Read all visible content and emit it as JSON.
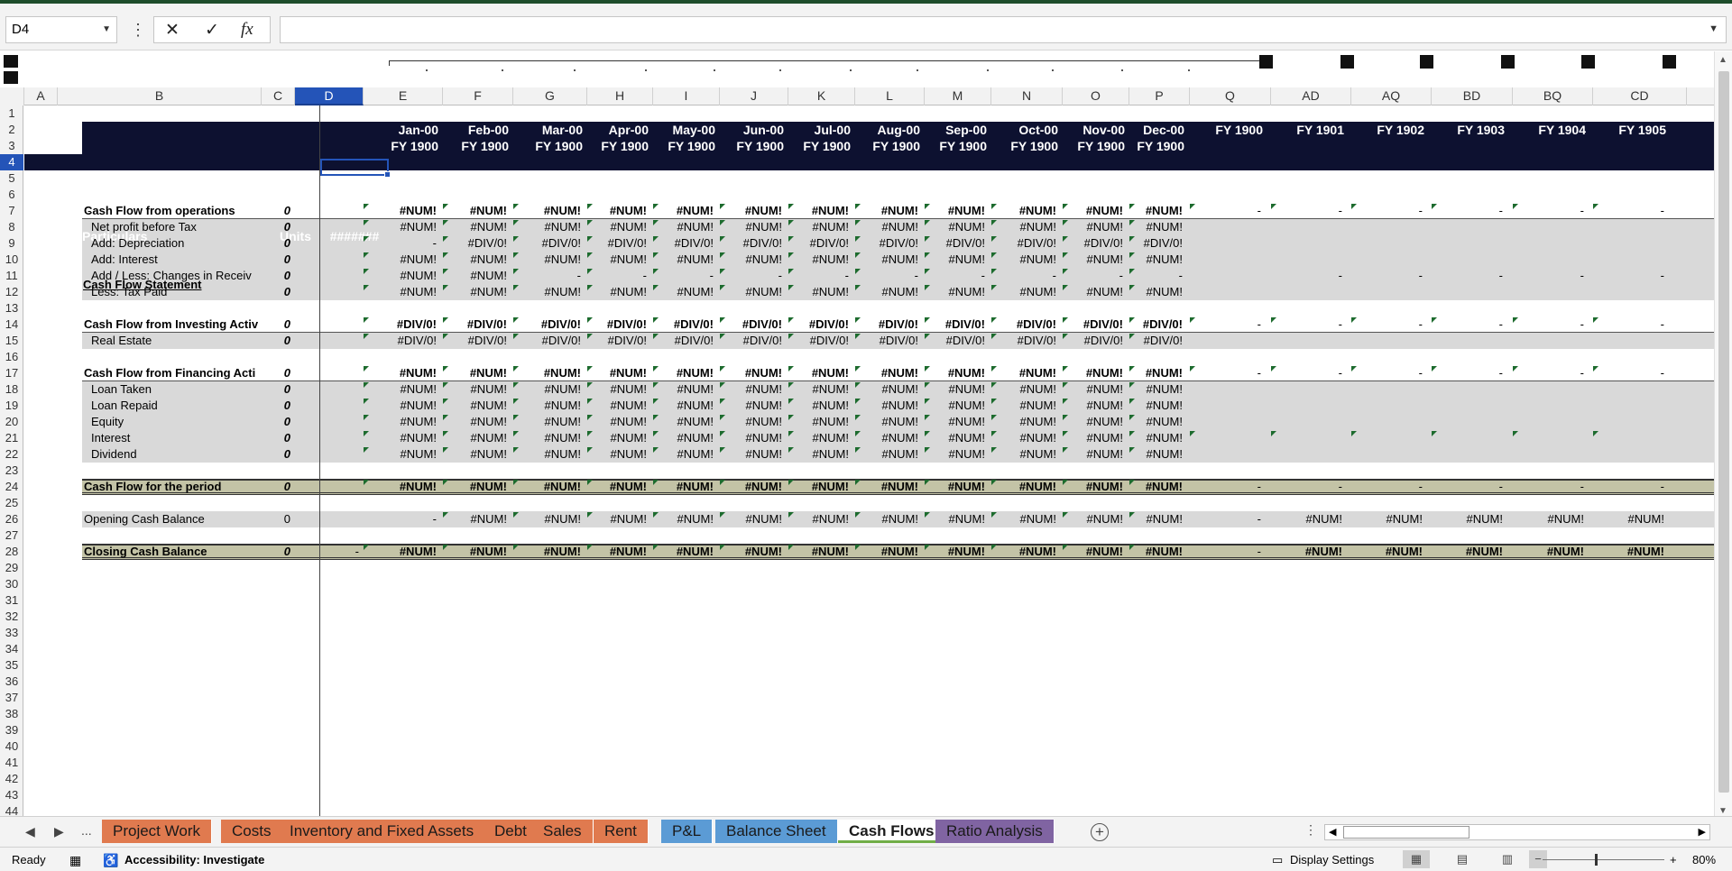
{
  "formula_bar": {
    "name_box": "D4",
    "cancel_icon": "✕",
    "enter_icon": "✓",
    "function_icon": "fx",
    "formula": ""
  },
  "columns": [
    {
      "label": "A"
    },
    {
      "label": "B"
    },
    {
      "label": "C"
    },
    {
      "label": "D",
      "selected": true
    },
    {
      "label": "E"
    },
    {
      "label": "F"
    },
    {
      "label": "G"
    },
    {
      "label": "H"
    },
    {
      "label": "I"
    },
    {
      "label": "J"
    },
    {
      "label": "K"
    },
    {
      "label": "L"
    },
    {
      "label": "M"
    },
    {
      "label": "N"
    },
    {
      "label": "O"
    },
    {
      "label": "P"
    },
    {
      "label": "Q"
    },
    {
      "label": "AD"
    },
    {
      "label": "AQ"
    },
    {
      "label": "BD"
    },
    {
      "label": "BQ"
    },
    {
      "label": "CD"
    }
  ],
  "rows": [
    "1",
    "2",
    "3",
    "4",
    "5",
    "6",
    "7",
    "8",
    "9",
    "10",
    "11",
    "12",
    "13",
    "14",
    "15",
    "16",
    "17",
    "18",
    "19",
    "20",
    "21",
    "22",
    "23",
    "24",
    "25",
    "26",
    "27",
    "28",
    "29",
    "30",
    "31",
    "32",
    "33",
    "34",
    "35",
    "36",
    "37",
    "38",
    "39",
    "40",
    "41",
    "42",
    "43",
    "44"
  ],
  "sheet": {
    "b1": "-",
    "header": {
      "particulars": "Particulars",
      "units": "Units",
      "d2": "#######",
      "months": [
        "Jan-00",
        "Feb-00",
        "Mar-00",
        "Apr-00",
        "May-00",
        "Jun-00",
        "Jul-00",
        "Aug-00",
        "Sep-00",
        "Oct-00",
        "Nov-00",
        "Dec-00"
      ],
      "fy_row3": [
        "FY 1900",
        "FY 1900",
        "FY 1900",
        "FY 1900",
        "FY 1900",
        "FY 1900",
        "FY 1900",
        "FY 1900",
        "FY 1900",
        "FY 1900",
        "FY 1900",
        "FY 1900"
      ],
      "years": [
        "FY 1900",
        "FY 1901",
        "FY 1902",
        "FY 1903",
        "FY 1904",
        "FY 1905"
      ]
    },
    "title": "Cash Flow Statement",
    "sections": [
      {
        "row": 7,
        "label": "Cash Flow from operations",
        "unit": "0",
        "bold": true,
        "line_below": true,
        "months": [
          "#NUM!",
          "#NUM!",
          "#NUM!",
          "#NUM!",
          "#NUM!",
          "#NUM!",
          "#NUM!",
          "#NUM!",
          "#NUM!",
          "#NUM!",
          "#NUM!",
          "#NUM!"
        ],
        "years": [
          "-",
          "-",
          "-",
          "-",
          "-",
          "-"
        ]
      },
      {
        "row": 8,
        "label": "Net profit before Tax",
        "unit": "0",
        "gray": true,
        "months": [
          "#NUM!",
          "#NUM!",
          "#NUM!",
          "#NUM!",
          "#NUM!",
          "#NUM!",
          "#NUM!",
          "#NUM!",
          "#NUM!",
          "#NUM!",
          "#NUM!",
          "#NUM!"
        ],
        "years": [
          "",
          "",
          "",
          "",
          "",
          ""
        ]
      },
      {
        "row": 9,
        "label": "Add: Depreciation",
        "unit": "0",
        "gray": true,
        "months": [
          "-",
          "#DIV/0!",
          "#DIV/0!",
          "#DIV/0!",
          "#DIV/0!",
          "#DIV/0!",
          "#DIV/0!",
          "#DIV/0!",
          "#DIV/0!",
          "#DIV/0!",
          "#DIV/0!",
          "#DIV/0!"
        ],
        "years": [
          "",
          "",
          "",
          "",
          "",
          ""
        ]
      },
      {
        "row": 10,
        "label": "Add: Interest",
        "unit": "0",
        "gray": true,
        "months": [
          "#NUM!",
          "#NUM!",
          "#NUM!",
          "#NUM!",
          "#NUM!",
          "#NUM!",
          "#NUM!",
          "#NUM!",
          "#NUM!",
          "#NUM!",
          "#NUM!",
          "#NUM!"
        ],
        "years": [
          "",
          "",
          "",
          "",
          "",
          ""
        ]
      },
      {
        "row": 11,
        "label": "Add / Less: Changes in Receiv",
        "unit": "0",
        "gray": true,
        "months": [
          "#NUM!",
          "#NUM!",
          "-",
          "-",
          "-",
          "-",
          "-",
          "-",
          "-",
          "-",
          "-",
          "-"
        ],
        "years": [
          "",
          "-",
          "-",
          "-",
          "-",
          "-"
        ]
      },
      {
        "row": 12,
        "label": "Less: Tax Paid",
        "unit": "0",
        "gray": true,
        "months": [
          "#NUM!",
          "#NUM!",
          "#NUM!",
          "#NUM!",
          "#NUM!",
          "#NUM!",
          "#NUM!",
          "#NUM!",
          "#NUM!",
          "#NUM!",
          "#NUM!",
          "#NUM!"
        ],
        "years": [
          "",
          "",
          "",
          "",
          "",
          ""
        ]
      },
      {
        "row": 14,
        "label": "Cash Flow from Investing Activ",
        "unit": "0",
        "bold": true,
        "line_below": true,
        "months": [
          "#DIV/0!",
          "#DIV/0!",
          "#DIV/0!",
          "#DIV/0!",
          "#DIV/0!",
          "#DIV/0!",
          "#DIV/0!",
          "#DIV/0!",
          "#DIV/0!",
          "#DIV/0!",
          "#DIV/0!",
          "#DIV/0!"
        ],
        "years": [
          "-",
          "-",
          "-",
          "-",
          "-",
          "-"
        ]
      },
      {
        "row": 15,
        "label": "Real Estate",
        "unit": "0",
        "gray": true,
        "months": [
          "#DIV/0!",
          "#DIV/0!",
          "#DIV/0!",
          "#DIV/0!",
          "#DIV/0!",
          "#DIV/0!",
          "#DIV/0!",
          "#DIV/0!",
          "#DIV/0!",
          "#DIV/0!",
          "#DIV/0!",
          "#DIV/0!"
        ],
        "years": [
          "",
          "",
          "",
          "",
          "",
          ""
        ]
      },
      {
        "row": 17,
        "label": "Cash Flow from Financing Acti",
        "unit": "0",
        "bold": true,
        "line_below": true,
        "months": [
          "#NUM!",
          "#NUM!",
          "#NUM!",
          "#NUM!",
          "#NUM!",
          "#NUM!",
          "#NUM!",
          "#NUM!",
          "#NUM!",
          "#NUM!",
          "#NUM!",
          "#NUM!"
        ],
        "years": [
          "-",
          "-",
          "-",
          "-",
          "-",
          "-"
        ]
      },
      {
        "row": 18,
        "label": "Loan Taken",
        "unit": "0",
        "gray": true,
        "months": [
          "#NUM!",
          "#NUM!",
          "#NUM!",
          "#NUM!",
          "#NUM!",
          "#NUM!",
          "#NUM!",
          "#NUM!",
          "#NUM!",
          "#NUM!",
          "#NUM!",
          "#NUM!"
        ],
        "years": [
          "",
          "",
          "",
          "",
          "",
          ""
        ]
      },
      {
        "row": 19,
        "label": "Loan Repaid",
        "unit": "0",
        "gray": true,
        "months": [
          "#NUM!",
          "#NUM!",
          "#NUM!",
          "#NUM!",
          "#NUM!",
          "#NUM!",
          "#NUM!",
          "#NUM!",
          "#NUM!",
          "#NUM!",
          "#NUM!",
          "#NUM!"
        ],
        "years": [
          "",
          "",
          "",
          "",
          "",
          ""
        ]
      },
      {
        "row": 20,
        "label": "Equity",
        "unit": "0",
        "gray": true,
        "months": [
          "#NUM!",
          "#NUM!",
          "#NUM!",
          "#NUM!",
          "#NUM!",
          "#NUM!",
          "#NUM!",
          "#NUM!",
          "#NUM!",
          "#NUM!",
          "#NUM!",
          "#NUM!"
        ],
        "years": [
          "",
          "",
          "",
          "",
          "",
          ""
        ]
      },
      {
        "row": 21,
        "label": "Interest",
        "unit": "0",
        "gray": true,
        "months": [
          "#NUM!",
          "#NUM!",
          "#NUM!",
          "#NUM!",
          "#NUM!",
          "#NUM!",
          "#NUM!",
          "#NUM!",
          "#NUM!",
          "#NUM!",
          "#NUM!",
          "#NUM!"
        ],
        "years": [
          "",
          "",
          "",
          "",
          "",
          ""
        ]
      },
      {
        "row": 22,
        "label": "Dividend",
        "unit": "0",
        "gray": true,
        "months": [
          "#NUM!",
          "#NUM!",
          "#NUM!",
          "#NUM!",
          "#NUM!",
          "#NUM!",
          "#NUM!",
          "#NUM!",
          "#NUM!",
          "#NUM!",
          "#NUM!",
          "#NUM!"
        ],
        "years": [
          "",
          "",
          "",
          "",
          "",
          ""
        ]
      },
      {
        "row": 24,
        "label": "Cash Flow for the period",
        "unit": "0",
        "bold": true,
        "total": true,
        "months": [
          "#NUM!",
          "#NUM!",
          "#NUM!",
          "#NUM!",
          "#NUM!",
          "#NUM!",
          "#NUM!",
          "#NUM!",
          "#NUM!",
          "#NUM!",
          "#NUM!",
          "#NUM!"
        ],
        "years": [
          "-",
          "-",
          "-",
          "-",
          "-",
          "-"
        ]
      },
      {
        "row": 26,
        "label": "Opening Cash Balance",
        "unit": "0",
        "gray": true,
        "plainunit": true,
        "months": [
          "-",
          "#NUM!",
          "#NUM!",
          "#NUM!",
          "#NUM!",
          "#NUM!",
          "#NUM!",
          "#NUM!",
          "#NUM!",
          "#NUM!",
          "#NUM!",
          "#NUM!"
        ],
        "years": [
          "-",
          "#NUM!",
          "#NUM!",
          "#NUM!",
          "#NUM!",
          "#NUM!"
        ]
      },
      {
        "row": 28,
        "label": "Closing Cash Balance",
        "unit": "0",
        "bold": true,
        "total": true,
        "d": "-",
        "months": [
          "#NUM!",
          "#NUM!",
          "#NUM!",
          "#NUM!",
          "#NUM!",
          "#NUM!",
          "#NUM!",
          "#NUM!",
          "#NUM!",
          "#NUM!",
          "#NUM!",
          "#NUM!"
        ],
        "years": [
          "-",
          "#NUM!",
          "#NUM!",
          "#NUM!",
          "#NUM!",
          "#NUM!"
        ]
      }
    ]
  },
  "tabs": [
    {
      "label": "Project Work",
      "color": "orange"
    },
    {
      "label": "Costs",
      "color": "orange"
    },
    {
      "label": "Inventory and Fixed Assets",
      "color": "orange"
    },
    {
      "label": "Debt",
      "color": "orange"
    },
    {
      "label": "Sales",
      "color": "orange"
    },
    {
      "label": "Rent",
      "color": "orange"
    },
    {
      "label": "P&L",
      "color": "blue"
    },
    {
      "label": "Balance Sheet",
      "color": "blue"
    },
    {
      "label": "Cash Flows",
      "color": "green",
      "active": true
    },
    {
      "label": "Ratio Analysis",
      "color": "purple"
    }
  ],
  "tab_nav": {
    "prev": "◀",
    "next": "▶",
    "more": "..."
  },
  "status": {
    "ready": "Ready",
    "accessibility": "Accessibility: Investigate",
    "display_settings": "Display Settings",
    "zoom": "80%"
  },
  "colors": {
    "accent": "#2454b8",
    "navy": "#0d1130",
    "tab_orange": "#e07a4f",
    "tab_blue": "#5b9bd5",
    "tab_green": "#70ad47",
    "tab_purple": "#8064a2"
  }
}
